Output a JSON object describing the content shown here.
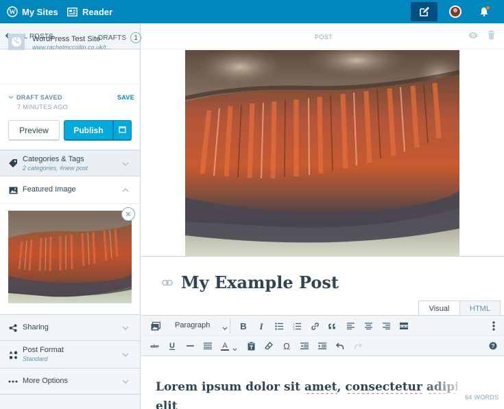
{
  "masterbar": {
    "my_sites_label": "My Sites",
    "reader_label": "Reader",
    "write_icon": "pencil-square-icon",
    "notifications_icon": "bell-icon",
    "brand_color": "#0087be",
    "active_color": "#005082"
  },
  "sidebar": {
    "back_label": "ALL POSTS",
    "drafts_label": "DRAFTS",
    "drafts_count": "1",
    "site_name": "WordPress Test Site",
    "site_url": "www.rachelmccollin.co.uk/t...",
    "status_label": "DRAFT SAVED",
    "status_time": "7 MINUTES AGO",
    "save_label": "SAVE",
    "preview_label": "Preview",
    "publish_label": "Publish",
    "accordions": {
      "categories": {
        "title": "Categories & Tags",
        "subtitle": "2 categories, #new post",
        "icon": "tag-icon"
      },
      "featured": {
        "title": "Featured Image",
        "icon": "image-icon"
      },
      "sharing": {
        "title": "Sharing",
        "icon": "share-icon"
      },
      "format": {
        "title": "Post Format",
        "subtitle": "Standard",
        "icon": "shapes-icon"
      },
      "more": {
        "title": "More Options",
        "icon": "ellipsis-icon"
      }
    }
  },
  "editor": {
    "post_type_label": "POST",
    "title": "My Example Post",
    "tabs": {
      "visual": "Visual",
      "html": "HTML"
    },
    "paragraph_select": "Paragraph",
    "body_line1_a": "Lorem ipsum dolor sit ",
    "body_line1_b": "amet",
    "body_line1_c": ", ",
    "body_line1_d": "consectetur",
    "body_line1_e": " ",
    "body_line1_f": "adipiscing",
    "body_line2": "elit",
    "word_count": "64 WORDS",
    "publish_color": "#00aadc"
  }
}
